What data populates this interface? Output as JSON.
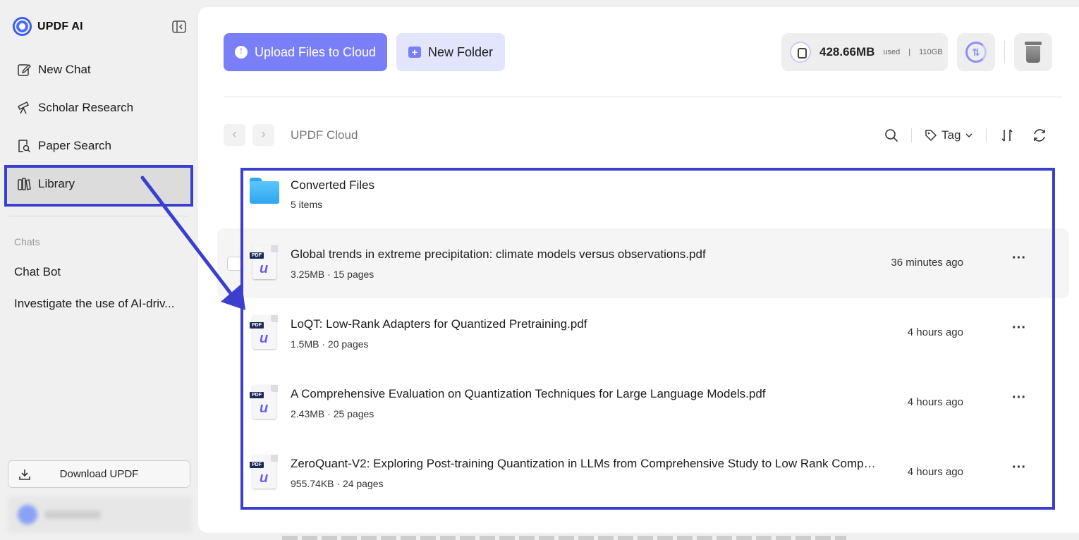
{
  "app": {
    "name": "UPDF AI",
    "accent": "#7b7ff7",
    "highlight": "#3b3fce"
  },
  "sidebar": {
    "items": [
      {
        "label": "New Chat",
        "icon": "edit-icon"
      },
      {
        "label": "Scholar Research",
        "icon": "telescope-icon"
      },
      {
        "label": "Paper Search",
        "icon": "document-search-icon"
      },
      {
        "label": "Library",
        "icon": "library-icon",
        "active": true
      }
    ],
    "chats_heading": "Chats",
    "chats": [
      "Chat Bot",
      "Investigate the use of AI-driv..."
    ],
    "download_label": "Download UPDF"
  },
  "main": {
    "upload_label": "Upload Files to Cloud",
    "new_folder_label": "New Folder",
    "storage": {
      "used": "428.66MB",
      "used_word": "used",
      "separator": "|",
      "total": "110GB"
    },
    "breadcrumb": "UPDF Cloud",
    "nav_prev": "‹",
    "nav_next": "›",
    "tag_label": "Tag",
    "folder": {
      "name": "Converted Files",
      "meta": "5 items"
    },
    "files": [
      {
        "name": "Global trends in extreme precipitation: climate models versus observations.pdf",
        "meta": "3.25MB · 15 pages",
        "time": "36 minutes ago",
        "more": "···",
        "pdf_tag": "PDF",
        "logo": "u"
      },
      {
        "name": "LoQT: Low-Rank Adapters for Quantized Pretraining.pdf",
        "meta": "1.5MB · 20 pages",
        "time": "4 hours ago",
        "more": "···",
        "pdf_tag": "PDF",
        "logo": "u"
      },
      {
        "name": "A Comprehensive Evaluation on Quantization Techniques for Large Language Models.pdf",
        "meta": "2.43MB · 25 pages",
        "time": "4 hours ago",
        "more": "···",
        "pdf_tag": "PDF",
        "logo": "u"
      },
      {
        "name": "ZeroQuant-V2: Exploring Post-training Quantization in LLMs from Comprehensive Study to Low Rank Compe...",
        "meta": "955.74KB · 24 pages",
        "time": "4 hours ago",
        "more": "···",
        "pdf_tag": "PDF",
        "logo": "u"
      }
    ]
  }
}
